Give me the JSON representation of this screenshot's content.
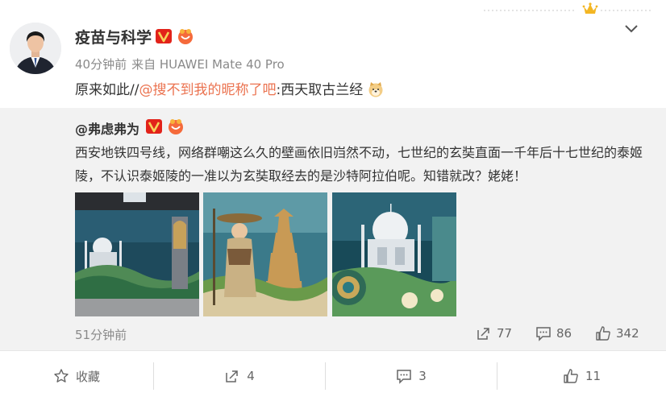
{
  "post": {
    "author": "疫苗与科学",
    "time": "40分钟前",
    "source": "来自 HUAWEI Mate 40 Pro",
    "text_prefix": "原来如此//",
    "mention": "@搜不到我的昵称了吧",
    "text_suffix": ":西天取古兰经"
  },
  "repost": {
    "author": "@弗虑弗为",
    "text": "西安地铁四号线，网络群嘲这么久的壁画依旧岿然不动，七世纪的玄奘直面一千年后十七世纪的泰姬陵，不认识泰姬陵的一准以为玄奘取经去的是沙特阿拉伯呢。知错就改？姥姥！",
    "time": "51分钟前",
    "reposts": "77",
    "comments": "86",
    "likes": "342"
  },
  "actions": {
    "favorite": "收藏",
    "repost": "4",
    "comment": "3",
    "like": "11"
  },
  "colors": {
    "mention": "#eb7350",
    "repost_bg": "#f2f2f2",
    "muted": "#8a8a8a"
  },
  "icons": [
    "crown-icon",
    "verified-v-icon",
    "member-icon",
    "chevron-down-icon",
    "doge-emoji-icon",
    "share-icon",
    "comment-icon",
    "like-icon",
    "star-icon"
  ]
}
